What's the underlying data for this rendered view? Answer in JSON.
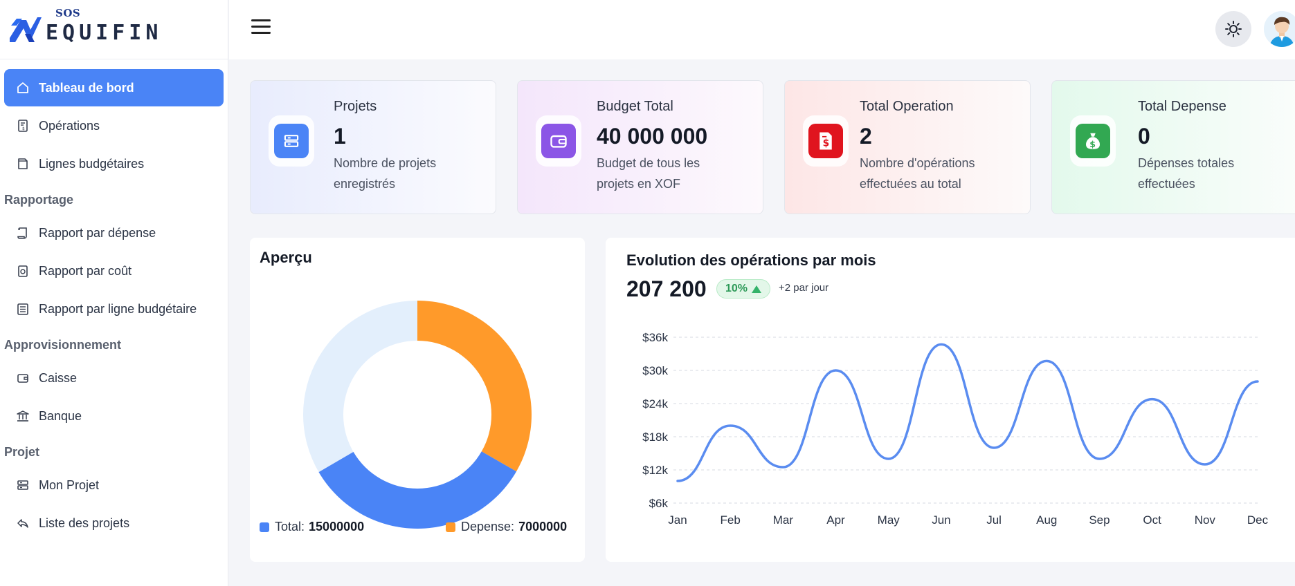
{
  "brand": {
    "sos": "SOS",
    "name": "EQUIFIN"
  },
  "sidebar": {
    "items_top": [
      {
        "label": "Tableau de bord",
        "icon": "home-icon",
        "active": true
      },
      {
        "label": "Opérations",
        "icon": "receipt-icon"
      },
      {
        "label": "Lignes budgétaires",
        "icon": "note-icon"
      }
    ],
    "section_reporting": "Rapportage",
    "items_reporting": [
      {
        "label": "Rapport par dépense",
        "icon": "scroll-icon"
      },
      {
        "label": "Rapport par coût",
        "icon": "cost-report-icon"
      },
      {
        "label": "Rapport par ligne budgétaire",
        "icon": "list-report-icon"
      }
    ],
    "section_supply": "Approvisionnement",
    "items_supply": [
      {
        "label": "Caisse",
        "icon": "wallet-icon"
      },
      {
        "label": "Banque",
        "icon": "bank-icon"
      }
    ],
    "section_project": "Projet",
    "items_project": [
      {
        "label": "Mon Projet",
        "icon": "server-icon"
      },
      {
        "label": "Liste des projets",
        "icon": "reply-icon"
      }
    ]
  },
  "stats": [
    {
      "title": "Projets",
      "value": "1",
      "desc": "Nombre de projets enregistrés",
      "icon": "server-icon",
      "color": "#4a84f6"
    },
    {
      "title": "Budget Total",
      "value": "40 000 000",
      "desc": "Budget de tous les projets en XOF",
      "icon": "wallet-icon",
      "color": "#8b55e6"
    },
    {
      "title": "Total Operation",
      "value": "2",
      "desc": "Nombre d'opérations effectuées au total",
      "icon": "invoice-dollar-icon",
      "color": "#e0141e"
    },
    {
      "title": "Total Depense",
      "value": "0",
      "desc": "Dépenses totales effectuées",
      "icon": "money-bag-icon",
      "color": "#32a852"
    }
  ],
  "overview": {
    "title": "Aperçu",
    "legend_total_label": "Total:",
    "legend_total_value": "15000000",
    "legend_depense_label": "Depense:",
    "legend_depense_value": "7000000"
  },
  "evolution": {
    "title": "Evolution des opérations par mois",
    "amount": "207 200",
    "badge": "10%",
    "note": "+2 par jour"
  },
  "chart_data": [
    {
      "type": "pie",
      "title": "Aperçu",
      "slices": [
        {
          "name": "",
          "value": 33.3,
          "color": "#ff9a2a"
        },
        {
          "name": "",
          "value": 33.3,
          "color": "#4a84f6"
        },
        {
          "name": "",
          "value": 33.4,
          "color": "#e3effc"
        }
      ],
      "legend": [
        "Total: 15000000",
        "Depense: 7000000"
      ],
      "legend_placement": "bottom"
    },
    {
      "type": "line",
      "title": "Evolution des opérations par mois",
      "categories": [
        "Jan",
        "Feb",
        "Mar",
        "Apr",
        "May",
        "Jun",
        "Jul",
        "Aug",
        "Sep",
        "Oct",
        "Nov",
        "Dec"
      ],
      "series": [
        {
          "values": [
            10000,
            20000,
            12500,
            30000,
            14000,
            34700,
            16000,
            31700,
            14000,
            24800,
            13000,
            28000
          ],
          "color": "#5a8cf0"
        }
      ],
      "yticks": [
        "$6k",
        "$12k",
        "$18k",
        "$24k",
        "$30k",
        "$36k"
      ],
      "ylim": [
        6000,
        36000
      ],
      "grid": true
    }
  ]
}
